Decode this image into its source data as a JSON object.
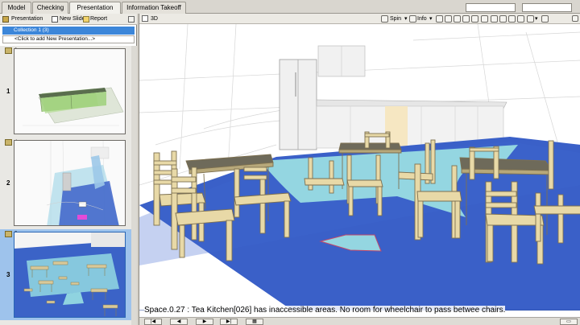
{
  "tabs": [
    {
      "label": "Model"
    },
    {
      "label": "Checking"
    },
    {
      "label": "Presentation"
    },
    {
      "label": "Information Takeoff"
    }
  ],
  "left_toolbar": {
    "presentation_label": "Presentation",
    "new_slide_label": "New Slide",
    "report_label": "Report"
  },
  "collection": {
    "label": "Collection 1 (3)",
    "add_placeholder": "<Click to add New Presentation...>"
  },
  "slides": [
    {
      "number": "1",
      "index": "3"
    },
    {
      "number": "2",
      "index": "4"
    },
    {
      "number": "3",
      "index": "5"
    }
  ],
  "viewport": {
    "label": "3D",
    "spin_label": "Spin",
    "info_label": "Info"
  },
  "status_message": "Space.0.27 : Tea Kitchen[026] has inaccessible areas. No room for wheelchair to pass betwee chairs."
}
